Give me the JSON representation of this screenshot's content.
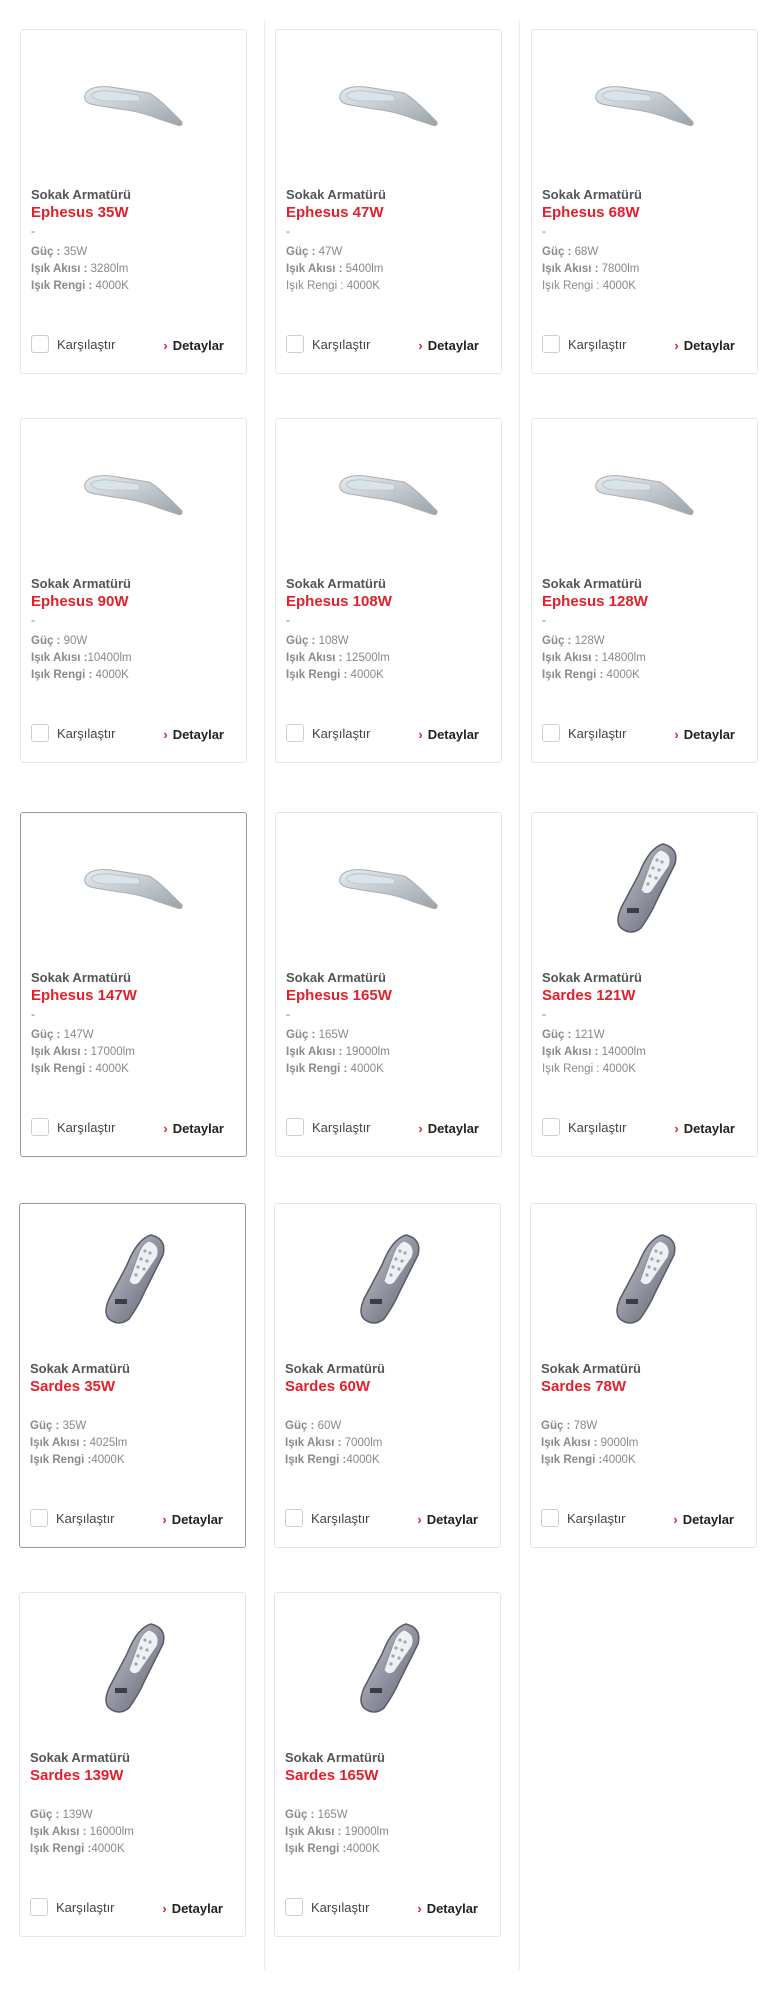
{
  "accent_color": "#e3202b",
  "compare_label": "Karşılaştır",
  "details_label": "Detaylar",
  "products": [
    {
      "category": "Sokak Armatürü",
      "name": "Ephesus 35W",
      "dash": "-",
      "specs": [
        {
          "label": "Güç :",
          "value": " 35W"
        },
        {
          "label": "Işık Akısı :",
          "value": " 3280lm"
        },
        {
          "label": "Işık Rengi :",
          "value": " 4000K"
        }
      ],
      "image": "ephesus-streetlight-icon"
    },
    {
      "category": "Sokak Armatürü",
      "name": "Ephesus 47W",
      "dash": "-",
      "specs": [
        {
          "label": "Güç :",
          "value": " 47W"
        },
        {
          "label": "Işık Akısı :",
          "value": " 5400lm"
        },
        {
          "label": "Işık Rengi :",
          "value": " 4000K",
          "plain": true
        }
      ],
      "image": "ephesus-streetlight-icon"
    },
    {
      "category": "Sokak Armatürü",
      "name": "Ephesus 68W",
      "dash": "-",
      "specs": [
        {
          "label": "Güç :",
          "value": " 68W"
        },
        {
          "label": "Işık Akısı :",
          "value": " 7800lm"
        },
        {
          "label": "Işık Rengi :",
          "value": " 4000K",
          "plain": true
        }
      ],
      "image": "ephesus-streetlight-icon"
    },
    {
      "category": "Sokak Armatürü",
      "name": "Ephesus 90W",
      "dash": "-",
      "specs": [
        {
          "label": "Güç :",
          "value": " 90W"
        },
        {
          "label": "Işık Akısı :",
          "value": "10400lm"
        },
        {
          "label": "Işık Rengi :",
          "value": " 4000K"
        }
      ],
      "image": "ephesus-streetlight-icon"
    },
    {
      "category": "Sokak Armatürü",
      "name": "Ephesus 108W",
      "dash": "-",
      "specs": [
        {
          "label": "Güç :",
          "value": " 108W"
        },
        {
          "label": "Işık Akısı :",
          "value": " 12500lm"
        },
        {
          "label": "Işık Rengi :",
          "value": " 4000K"
        }
      ],
      "image": "ephesus-streetlight-icon"
    },
    {
      "category": "Sokak Armatürü",
      "name": "Ephesus 128W",
      "dash": "-",
      "specs": [
        {
          "label": "Güç :",
          "value": " 128W"
        },
        {
          "label": "Işık Akısı :",
          "value": " 14800lm"
        },
        {
          "label": "Işık Rengi :",
          "value": " 4000K"
        }
      ],
      "image": "ephesus-streetlight-icon"
    },
    {
      "category": "Sokak Armatürü",
      "name": "Ephesus 147W",
      "dash": "-",
      "specs": [
        {
          "label": "Güç :",
          "value": " 147W"
        },
        {
          "label": "Işık Akısı :",
          "value": " 17000lm"
        },
        {
          "label": "Işık Rengi :",
          "value": " 4000K"
        }
      ],
      "image": "ephesus-streetlight-icon",
      "highlighted": true
    },
    {
      "category": "Sokak Armatürü",
      "name": "Ephesus 165W",
      "dash": "-",
      "specs": [
        {
          "label": "Güç :",
          "value": " 165W"
        },
        {
          "label": "Işık Akısı :",
          "value": " 19000lm"
        },
        {
          "label": "Işık Rengi :",
          "value": " 4000K"
        }
      ],
      "image": "ephesus-streetlight-icon"
    },
    {
      "category": "Sokak Armatürü",
      "name": "Sardes 121W",
      "dash": "-",
      "specs": [
        {
          "label": "Güç :",
          "value": " 121W"
        },
        {
          "label": "Işık Akısı :",
          "value": " 14000lm"
        },
        {
          "label": "Işık Rengi :",
          "value": " 4000K",
          "plain": true
        }
      ],
      "image": "sardes-streetlight-icon"
    },
    {
      "category": "Sokak Armatürü",
      "name": "Sardes 35W",
      "dash": "",
      "specs": [
        {
          "label": "Güç :",
          "value": " 35W"
        },
        {
          "label": "Işık Akısı :",
          "value": " 4025lm"
        },
        {
          "label": "Işık Rengi :",
          "value": "4000K"
        }
      ],
      "image": "sardes-streetlight-icon",
      "highlighted": true
    },
    {
      "category": "Sokak Armatürü",
      "name": "Sardes 60W",
      "dash": "",
      "specs": [
        {
          "label": "Güç :",
          "value": " 60W"
        },
        {
          "label": "Işık Akısı :",
          "value": " 7000lm"
        },
        {
          "label": "Işık Rengi :",
          "value": "4000K"
        }
      ],
      "image": "sardes-streetlight-icon"
    },
    {
      "category": "Sokak Armatürü",
      "name": "Sardes 78W",
      "dash": "",
      "specs": [
        {
          "label": "Güç :",
          "value": " 78W"
        },
        {
          "label": "Işık Akısı :",
          "value": " 9000lm"
        },
        {
          "label": "Işık Rengi :",
          "value": "4000K"
        }
      ],
      "image": "sardes-streetlight-icon"
    },
    {
      "category": "Sokak Armatürü",
      "name": "Sardes 139W",
      "dash": "",
      "specs": [
        {
          "label": "Güç :",
          "value": " 139W"
        },
        {
          "label": "Işık Akısı :",
          "value": " 16000lm"
        },
        {
          "label": "Işık Rengi :",
          "value": "4000K"
        }
      ],
      "image": "sardes-streetlight-icon"
    },
    {
      "category": "Sokak Armatürü",
      "name": "Sardes 165W",
      "dash": "",
      "specs": [
        {
          "label": "Güç :",
          "value": " 165W"
        },
        {
          "label": "Işık Akısı :",
          "value": " 19000lm"
        },
        {
          "label": "Işık Rengi :",
          "value": "4000K"
        }
      ],
      "image": "sardes-streetlight-icon"
    }
  ]
}
